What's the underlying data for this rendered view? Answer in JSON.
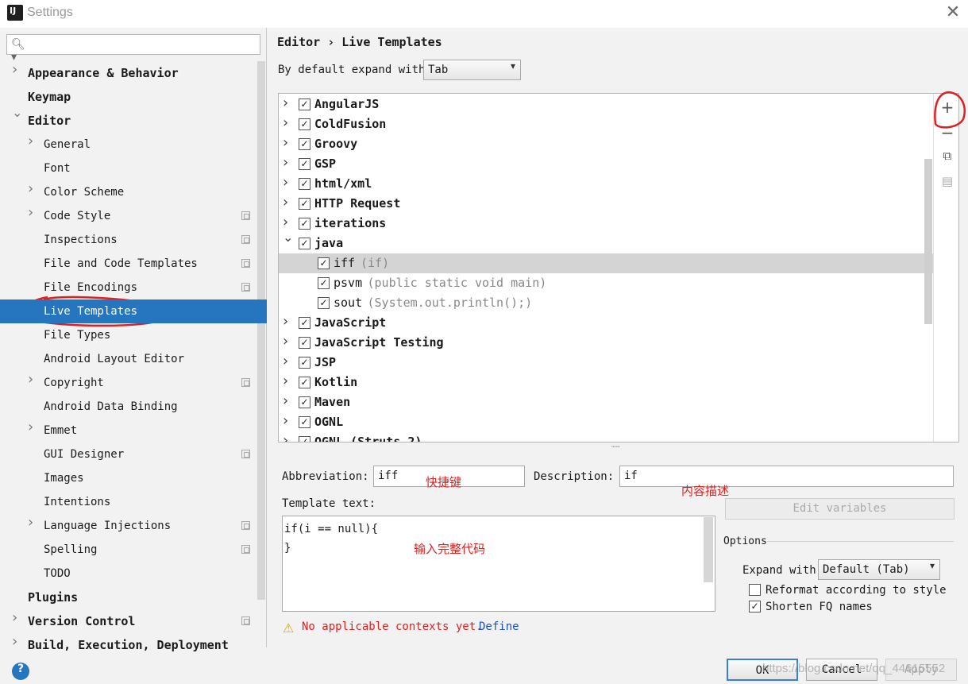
{
  "window": {
    "title": "Settings",
    "app_icon_text": "IJ"
  },
  "search": {
    "placeholder": "",
    "icon": "search-icon"
  },
  "sidebar": {
    "items": [
      {
        "label": "Appearance & Behavior",
        "level": 0,
        "expandable": true,
        "expanded": false
      },
      {
        "label": "Keymap",
        "level": 0,
        "expandable": false
      },
      {
        "label": "Editor",
        "level": 0,
        "expandable": true,
        "expanded": true
      },
      {
        "label": "General",
        "level": 1,
        "expandable": true
      },
      {
        "label": "Font",
        "level": 1
      },
      {
        "label": "Color Scheme",
        "level": 1,
        "expandable": true
      },
      {
        "label": "Code Style",
        "level": 1,
        "expandable": true,
        "project_icon": true
      },
      {
        "label": "Inspections",
        "level": 1,
        "project_icon": true
      },
      {
        "label": "File and Code Templates",
        "level": 1,
        "project_icon": true
      },
      {
        "label": "File Encodings",
        "level": 1,
        "project_icon": true
      },
      {
        "label": "Live Templates",
        "level": 1,
        "selected": true
      },
      {
        "label": "File Types",
        "level": 1
      },
      {
        "label": "Android Layout Editor",
        "level": 1
      },
      {
        "label": "Copyright",
        "level": 1,
        "expandable": true,
        "project_icon": true
      },
      {
        "label": "Android Data Binding",
        "level": 1
      },
      {
        "label": "Emmet",
        "level": 1,
        "expandable": true
      },
      {
        "label": "GUI Designer",
        "level": 1,
        "project_icon": true
      },
      {
        "label": "Images",
        "level": 1
      },
      {
        "label": "Intentions",
        "level": 1
      },
      {
        "label": "Language Injections",
        "level": 1,
        "expandable": true,
        "project_icon": true
      },
      {
        "label": "Spelling",
        "level": 1,
        "project_icon": true
      },
      {
        "label": "TODO",
        "level": 1
      },
      {
        "label": "Plugins",
        "level": 0
      },
      {
        "label": "Version Control",
        "level": 0,
        "expandable": true,
        "project_icon": true
      },
      {
        "label": "Build, Execution, Deployment",
        "level": 0,
        "expandable": true
      }
    ]
  },
  "main": {
    "breadcrumb": "Editor  › Live Templates",
    "expand_label": "By default expand with",
    "expand_value": "Tab",
    "tree": [
      {
        "label": "AngularJS",
        "checked": true,
        "group": true
      },
      {
        "label": "ColdFusion",
        "checked": true,
        "group": true
      },
      {
        "label": "Groovy",
        "checked": true,
        "group": true
      },
      {
        "label": "GSP",
        "checked": true,
        "group": true
      },
      {
        "label": "html/xml",
        "checked": true,
        "group": true
      },
      {
        "label": "HTTP Request",
        "checked": true,
        "group": true
      },
      {
        "label": "iterations",
        "checked": true,
        "group": true
      },
      {
        "label": "java",
        "checked": true,
        "group": true,
        "expanded": true
      },
      {
        "label": "iff",
        "desc": "(if)",
        "checked": true,
        "group": false,
        "selected": true
      },
      {
        "label": "psvm",
        "desc": "(public static void main)",
        "checked": true,
        "group": false
      },
      {
        "label": "sout",
        "desc": "(System.out.println();)",
        "checked": true,
        "group": false
      },
      {
        "label": "JavaScript",
        "checked": true,
        "group": true
      },
      {
        "label": "JavaScript Testing",
        "checked": true,
        "group": true
      },
      {
        "label": "JSP",
        "checked": true,
        "group": true
      },
      {
        "label": "Kotlin",
        "checked": true,
        "group": true
      },
      {
        "label": "Maven",
        "checked": true,
        "group": true
      },
      {
        "label": "OGNL",
        "checked": true,
        "group": true
      },
      {
        "label": "OGNL (Struts 2)",
        "checked": true,
        "group": true
      }
    ],
    "toolbar": [
      "add-icon",
      "remove-icon",
      "copy-icon",
      "edit-icon"
    ],
    "abbreviation_label": "Abbreviation:",
    "abbreviation_value": "iff",
    "description_label": "Description:",
    "description_value": "if",
    "template_text_label": "Template text:",
    "template_text": "if(i == null){\n}",
    "edit_variables_label": "Edit variables",
    "options_label": "Options",
    "expand_with_label": "Expand with",
    "expand_with_value": "Default (Tab)",
    "reformat_label": "Reformat according to style",
    "reformat_checked": false,
    "shorten_label": "Shorten FQ names",
    "shorten_checked": true,
    "warning_text": "No applicable contexts yet.",
    "define_link": "Define"
  },
  "annotations": {
    "abbrev_note": "快捷键",
    "desc_note": "内容描述",
    "template_note": "输入完整代码",
    "color": "#e02020"
  },
  "footer": {
    "ok": "OK",
    "cancel": "Cancel",
    "apply": "Apply",
    "watermark": "https://blog.csdn.net/qq_44615552"
  }
}
